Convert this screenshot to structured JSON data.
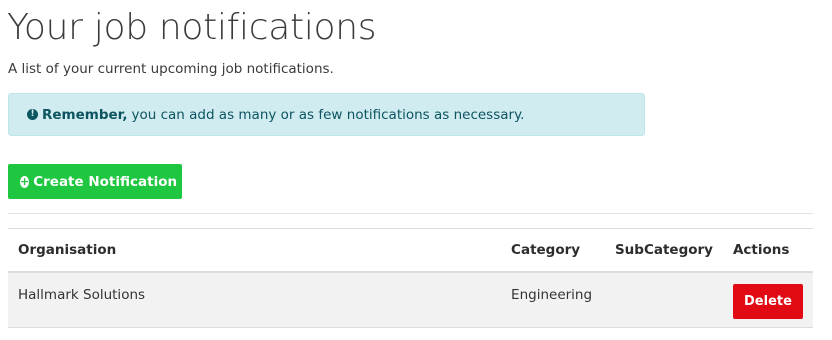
{
  "header": {
    "title": "Your job notifications",
    "subtitle": "A list of your current upcoming job notifications."
  },
  "alert": {
    "icon": "info-circle-icon",
    "emphasis": "Remember,",
    "message": "you can add as many or as few notifications as necessary."
  },
  "actions": {
    "create_label": "Create Notification",
    "create_icon": "plus-circle-icon"
  },
  "table": {
    "headers": {
      "organisation": "Organisation",
      "category": "Category",
      "subcategory": "SubCategory",
      "actions": "Actions"
    },
    "rows": [
      {
        "organisation": "Hallmark Solutions",
        "category": "Engineering",
        "subcategory": "",
        "delete_label": "Delete"
      }
    ]
  },
  "colors": {
    "create_button": "#1fc63f",
    "delete_button": "#e00914",
    "alert_background": "#d1ecf1",
    "alert_text": "#0c5460"
  }
}
